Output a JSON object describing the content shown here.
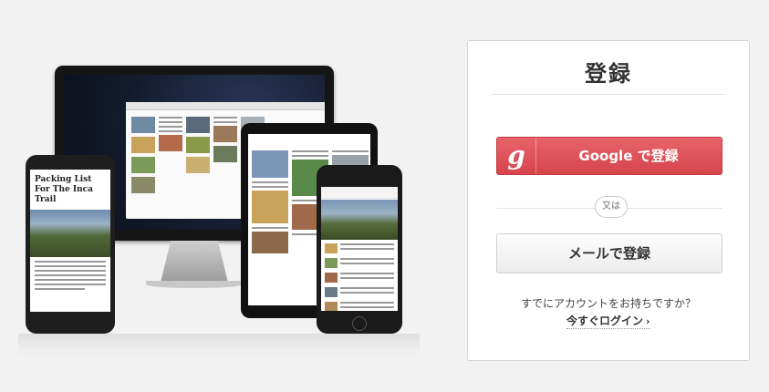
{
  "signup": {
    "title": "登録",
    "google_button_label": "Google で登録",
    "google_icon_glyph": "g",
    "or_label": "又は",
    "email_button_label": "メールで登録",
    "have_account_text": "すでにアカウントをお持ちですか？",
    "login_link_label": "今すぐログイン",
    "login_chevron": "›"
  },
  "illustration": {
    "android_article_title": "Packing List For The Inca Trail"
  },
  "colors": {
    "google_red": "#d6444c",
    "background": "#f2f2f2",
    "panel": "#ffffff"
  }
}
